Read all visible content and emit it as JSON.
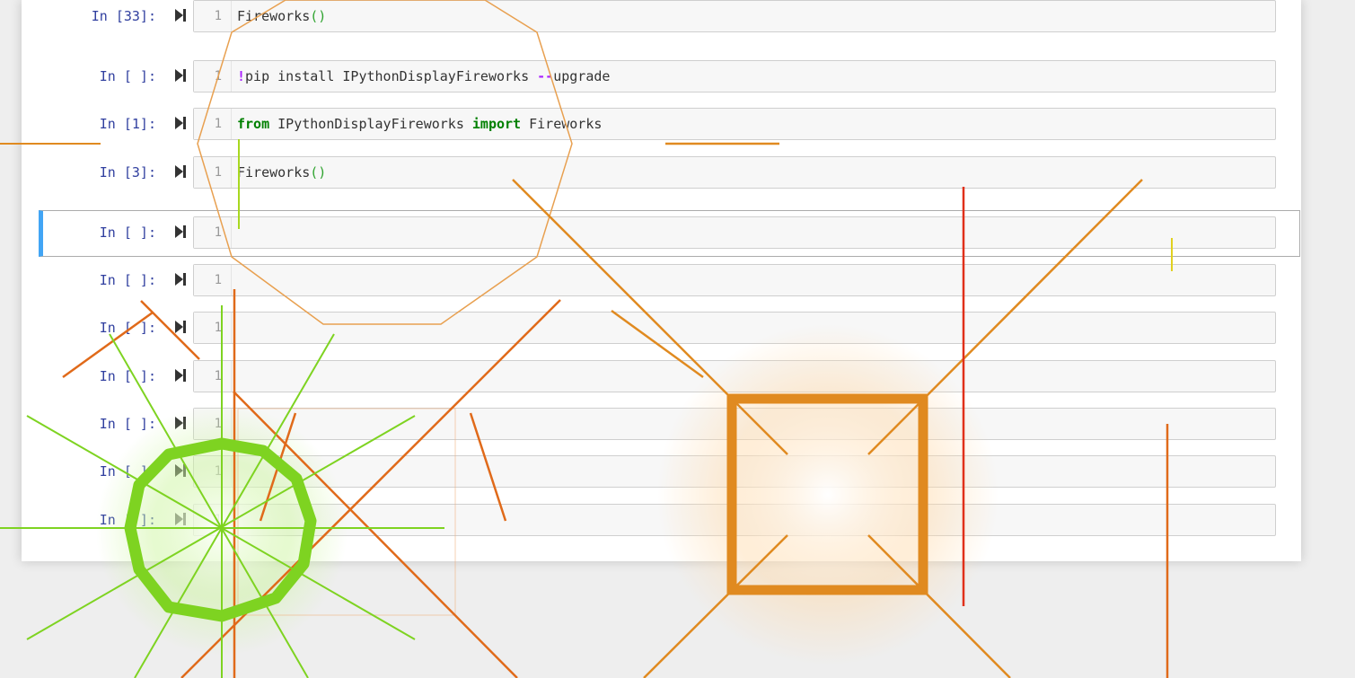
{
  "cells": [
    {
      "prompt": "In [33]:",
      "line": "1",
      "code": [
        "Fireworks",
        "()"
      ]
    },
    {
      "prompt": "In [ ]:",
      "line": "1",
      "code": [
        "!",
        "pip install IPythonDisplayFireworks ",
        "--",
        "upgrade"
      ]
    },
    {
      "prompt": "In [1]:",
      "line": "1",
      "code": [
        "from",
        " IPythonDisplayFireworks ",
        "import",
        " Fireworks"
      ]
    },
    {
      "prompt": "In [3]:",
      "line": "1",
      "code": [
        "Fireworks",
        "()"
      ]
    },
    {
      "prompt": "In [ ]:",
      "line": "1",
      "code": []
    },
    {
      "prompt": "In [ ]:",
      "line": "1",
      "code": []
    },
    {
      "prompt": "In [ ]:",
      "line": "1",
      "code": []
    },
    {
      "prompt": "In [ ]:",
      "line": "1",
      "code": []
    },
    {
      "prompt": "In [ ]:",
      "line": "1",
      "code": []
    },
    {
      "prompt": "In [ ]:",
      "line": "1",
      "code": []
    },
    {
      "prompt": "In [ ]:",
      "line": "1",
      "code": []
    }
  ],
  "colors": {
    "prompt": "#303f9f",
    "selected_border": "#42a5f5",
    "firework_orange": "#e08a20",
    "firework_deep_orange": "#e06a1a",
    "firework_green": "#7ed321",
    "firework_red": "#e0301a",
    "firework_yellow": "#e0d020"
  },
  "icons": {
    "run": "run-cell-icon"
  }
}
